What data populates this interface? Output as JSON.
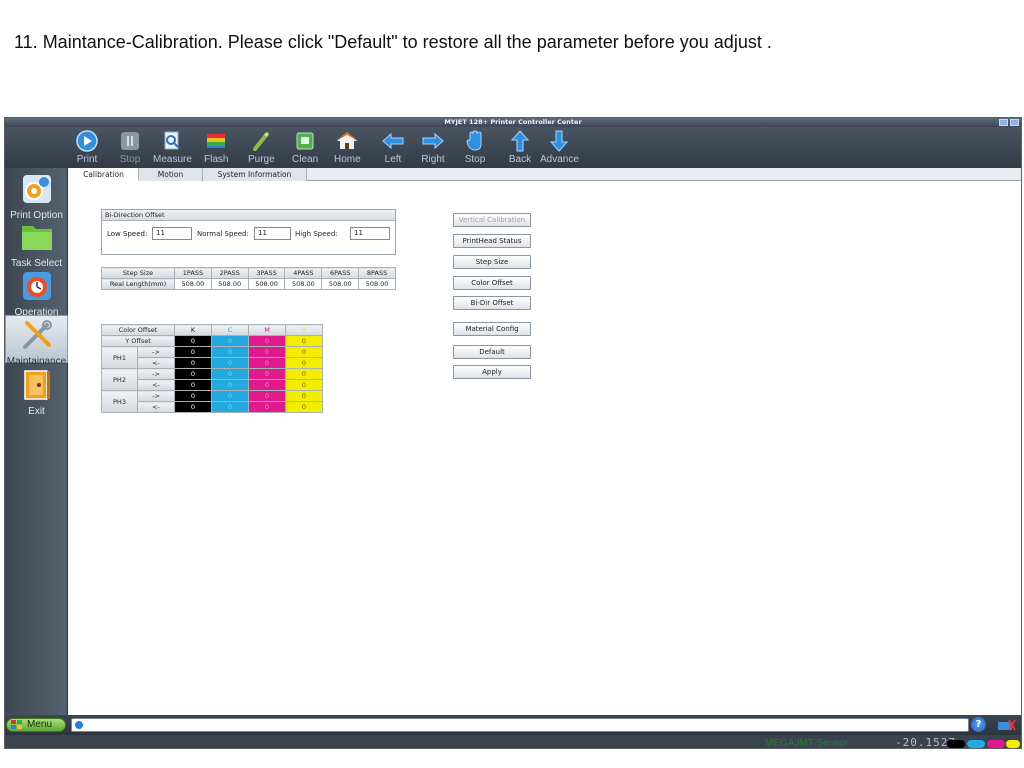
{
  "caption": "11. Maintance-Calibration. Please click \"Default\" to restore all the parameter before you adjust .",
  "window": {
    "title": "MYJET 128+ Printer Controller Center"
  },
  "toolbar": {
    "items": [
      {
        "label": "Print",
        "icon": "play-icon",
        "color": "#2f8fe0"
      },
      {
        "label": "Stop",
        "icon": "pause-icon",
        "color": "#8a96a4"
      },
      {
        "label": "Measure",
        "icon": "measure-icon",
        "color": "#5a8fd0"
      },
      {
        "label": "Flash",
        "icon": "flash-icon",
        "color": "#e0a020"
      },
      {
        "label": "Purge",
        "icon": "purge-icon",
        "color": "#8ac040"
      },
      {
        "label": "Clean",
        "icon": "clean-icon",
        "color": "#50b050"
      },
      {
        "label": "Home",
        "icon": "home-icon",
        "color": "#e87a20"
      },
      {
        "label": "Left",
        "icon": "arrow-left-icon",
        "color": "#2f8fe0"
      },
      {
        "label": "Right",
        "icon": "arrow-right-icon",
        "color": "#2f8fe0"
      },
      {
        "label": "Stop",
        "icon": "hand-stop-icon",
        "color": "#2f8fe0"
      },
      {
        "label": "Back",
        "icon": "arrow-up-icon",
        "color": "#2f8fe0"
      },
      {
        "label": "Advance",
        "icon": "arrow-down-icon",
        "color": "#2f8fe0"
      }
    ]
  },
  "sidebar": {
    "items": [
      {
        "label": "Print Option",
        "icon": "gear-icon"
      },
      {
        "label": "Task Select",
        "icon": "folder-icon"
      },
      {
        "label": "Operation",
        "icon": "operation-icon"
      },
      {
        "label": "Maintainance",
        "icon": "tools-icon",
        "active": true
      },
      {
        "label": "Exit",
        "icon": "exit-icon"
      }
    ]
  },
  "tabs": [
    {
      "label": "Calibration",
      "active": true
    },
    {
      "label": "Motion"
    },
    {
      "label": "System Information"
    }
  ],
  "bidir": {
    "title": "Bi-Direction Offset",
    "low_label": "Low Speed:",
    "low_value": "11",
    "normal_label": "Normal Speed:",
    "normal_value": "11",
    "high_label": "High Speed:",
    "high_value": "11"
  },
  "step_table": {
    "headers": [
      "Step Size",
      "1PASS",
      "2PASS",
      "3PASS",
      "4PASS",
      "6PASS",
      "8PASS"
    ],
    "row_label": "Real Length(mm)",
    "values": [
      "508.00",
      "508.00",
      "508.00",
      "508.00",
      "508.00",
      "508.00"
    ]
  },
  "color_table": {
    "headers": [
      "Color Offset",
      "K",
      "C",
      "M",
      "Y"
    ],
    "y_offset_label": "Y Offset",
    "y_offset_values": [
      "0",
      "0",
      "0",
      "0"
    ],
    "dir_forward": "->",
    "dir_back": "<-",
    "heads": [
      {
        "name": "PH1",
        "forward": [
          "0",
          "0",
          "0",
          "0"
        ],
        "back": [
          "0",
          "0",
          "0",
          "0"
        ]
      },
      {
        "name": "PH2",
        "forward": [
          "0",
          "0",
          "0",
          "0"
        ],
        "back": [
          "0",
          "0",
          "0",
          "0"
        ]
      },
      {
        "name": "PH3",
        "forward": [
          "0",
          "0",
          "0",
          "0"
        ],
        "back": [
          "0",
          "0",
          "0",
          "0"
        ]
      }
    ]
  },
  "buttons": {
    "vertical": "Vertical Calibration",
    "printhead": "PrintHead Status",
    "step": "Step Size",
    "color": "Color Offset",
    "bidir": "Bi-Dir Offset",
    "material": "Material Config",
    "default": "Default",
    "apply": "Apply"
  },
  "statusbar": {
    "menu_label": "Menu",
    "help": "?"
  },
  "footer": {
    "brand": "MEGAJMT Sensor",
    "lcd": "-20.1527"
  },
  "ink_colors": [
    "#000000",
    "#22a9e0",
    "#e0198c",
    "#f3ee00"
  ]
}
